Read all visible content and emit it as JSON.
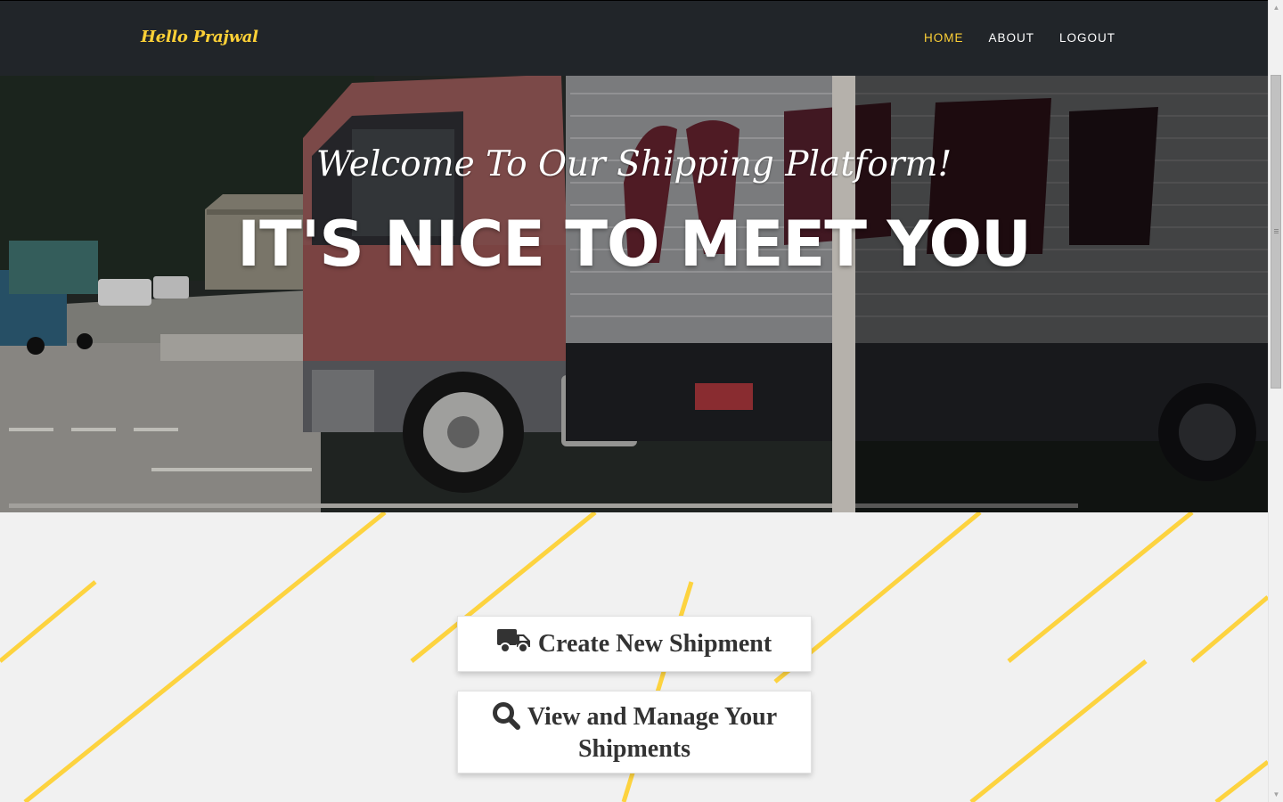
{
  "navbar": {
    "brand": "Hello Prajwal",
    "links": [
      {
        "label": "HOME",
        "active": true
      },
      {
        "label": "ABOUT",
        "active": false
      },
      {
        "label": "LOGOUT",
        "active": false
      }
    ]
  },
  "hero": {
    "subheading": "Welcome To Our Shipping Platform!",
    "heading": "IT'S NICE TO MEET YOU"
  },
  "actions": {
    "create_label": "Create New Shipment",
    "create_icon": "truck-icon",
    "view_label": "View and Manage Your Shipments",
    "view_icon": "search-icon"
  },
  "colors": {
    "accent": "#fed136",
    "navbar_bg": "#212529",
    "content_bg": "#f1f1f1"
  }
}
